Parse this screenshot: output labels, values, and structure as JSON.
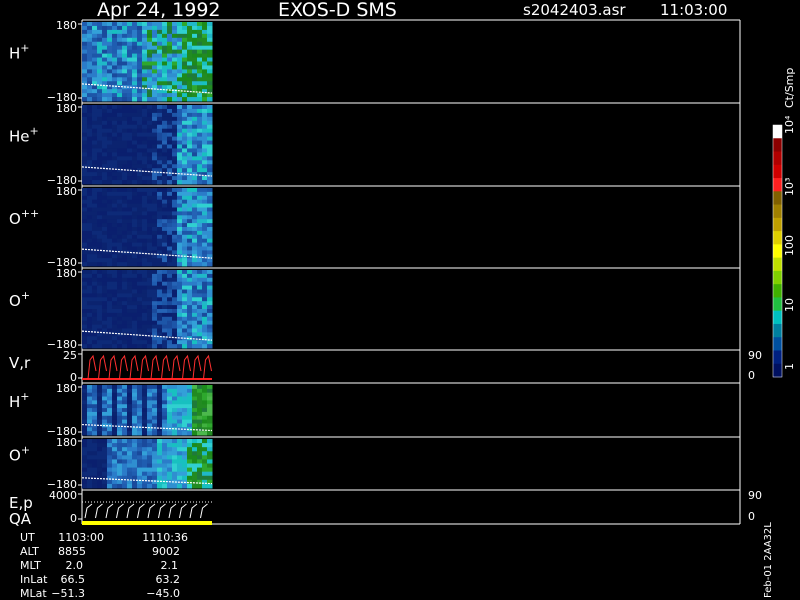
{
  "header": {
    "date": "Apr 24, 1992",
    "instrument": "EXOS-D SMS",
    "file": "s2042403.asr",
    "time": "11:03:00"
  },
  "colorbar": {
    "title": "Ct/Smp",
    "labels": [
      "10⁴",
      "10³",
      "100",
      "10",
      "1"
    ],
    "colors": [
      "#FFFFFF",
      "#8B0000",
      "#B00000",
      "#D00000",
      "#FF2020",
      "#806000",
      "#A08000",
      "#C0A000",
      "#E0D000",
      "#FFFF00",
      "#C0E000",
      "#80D000",
      "#40B000",
      "#20C040",
      "#00C0C0",
      "#0080A0",
      "#0050A0",
      "#002080",
      "#001060"
    ]
  },
  "chart_data": {
    "type": "heatmap",
    "panels": [
      {
        "label": "H",
        "sup": "+",
        "ytop": "180",
        "ybot": "−180",
        "style": "h1"
      },
      {
        "label": "He",
        "sup": "+",
        "ytop": "180",
        "ybot": "−180",
        "style": "he"
      },
      {
        "label": "O",
        "sup": "++",
        "ytop": "180",
        "ybot": "−180",
        "style": "opp"
      },
      {
        "label": "O",
        "sup": "+",
        "ytop": "180",
        "ybot": "−180",
        "style": "op1"
      },
      {
        "label": "V,r",
        "sup": "",
        "ytop": "25",
        "ybot": "0",
        "style": "line",
        "right_top": "90",
        "right_bot": "0"
      },
      {
        "label": "H",
        "sup": "+",
        "ytop": "180",
        "ybot": "−180",
        "style": "h2"
      },
      {
        "label": "O",
        "sup": "+",
        "ytop": "180",
        "ybot": "−180",
        "style": "op2"
      },
      {
        "label": "E,p",
        "label2": "QA",
        "sup": "",
        "ytop": "4000",
        "ybot": "0",
        "style": "ep",
        "right_top": "90",
        "right_bot": "0"
      }
    ]
  },
  "footer": {
    "labels": [
      "UT",
      "ALT",
      "MLT",
      "InLat",
      "MLat"
    ],
    "col1": [
      "1103:00",
      "8855",
      "2.0",
      "66.5",
      "−51.3"
    ],
    "col2": [
      "1110:36",
      "9002",
      "2.1",
      "63.2",
      "−45.0"
    ]
  },
  "side_text": "Feb-01 2AA32L"
}
